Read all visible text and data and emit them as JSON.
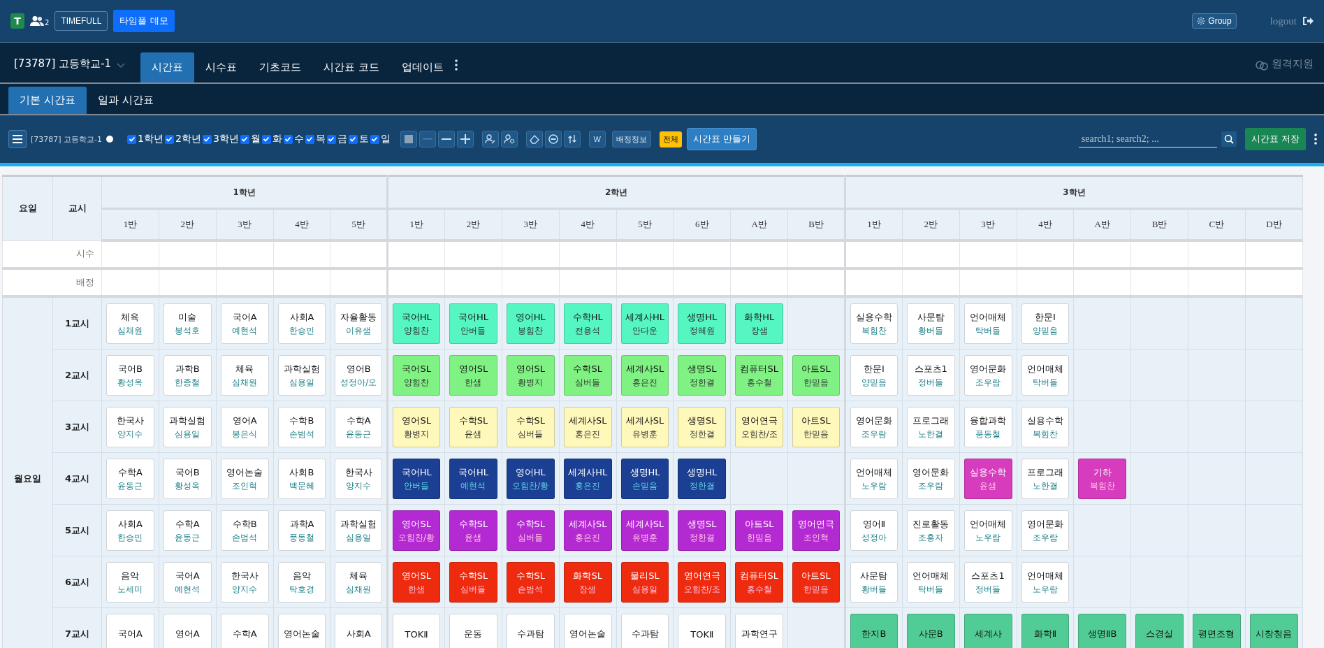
{
  "app_bar": {
    "logo": "T",
    "user_count": "2",
    "brand_button": "TIMEFULL",
    "demo_button": "타임풀 데모",
    "group_button": "Group",
    "logout": "logout"
  },
  "nav": {
    "school": "[73787] 고등학교-1",
    "remote": "원격지원",
    "tabs": [
      {
        "label": "시간표",
        "selected": true
      },
      {
        "label": "시수표",
        "selected": false
      },
      {
        "label": "기초코드",
        "selected": false
      },
      {
        "label": "시간표 코드",
        "selected": false
      },
      {
        "label": "업데이트",
        "selected": false
      }
    ]
  },
  "subtabs": [
    {
      "label": "기본 시간표",
      "selected": true
    },
    {
      "label": "일과 시간표",
      "selected": false
    }
  ],
  "toolbar": {
    "school": "[73787] 고등학교-1",
    "w_button": "W",
    "info_button": "배정정보",
    "all_badge": "전체",
    "make_button": "시간표 만들기",
    "search": {
      "placeholder": "search1; search2; ..."
    },
    "save_button": "시간표 저장",
    "filters": [
      {
        "label": "1학년",
        "checked": true
      },
      {
        "label": "2학년",
        "checked": true
      },
      {
        "label": "3학년",
        "checked": true
      },
      {
        "label": "월",
        "checked": true
      },
      {
        "label": "화",
        "checked": true
      },
      {
        "label": "수",
        "checked": true
      },
      {
        "label": "목",
        "checked": true
      },
      {
        "label": "금",
        "checked": true
      },
      {
        "label": "토",
        "checked": true
      },
      {
        "label": "일",
        "checked": true
      }
    ]
  },
  "table": {
    "day_header": "요일",
    "period_header": "교시",
    "summary_rows": [
      "시수",
      "배정"
    ],
    "day": "월요일",
    "grades": [
      {
        "name": "1학년",
        "classes": [
          "1반",
          "2반",
          "3반",
          "4반",
          "5반"
        ]
      },
      {
        "name": "2학년",
        "classes": [
          "1반",
          "2반",
          "3반",
          "4반",
          "5반",
          "6반",
          "A반",
          "B반"
        ]
      },
      {
        "name": "3학년",
        "classes": [
          "1반",
          "2반",
          "3반",
          "4반",
          "A반",
          "B반",
          "C반",
          "D반"
        ]
      }
    ],
    "periods": [
      {
        "label": "1교시",
        "cells": [
          {
            "subject": "체육",
            "teacher": "심채원",
            "color": "#ffffff"
          },
          {
            "subject": "미술",
            "teacher": "봉석호",
            "color": "#ffffff"
          },
          {
            "subject": "국어A",
            "teacher": "예현석",
            "color": "#ffffff"
          },
          {
            "subject": "사회A",
            "teacher": "한승민",
            "color": "#ffffff"
          },
          {
            "subject": "자율활동",
            "teacher": "이유샘",
            "color": "#ffffff"
          },
          {
            "subject": "국어HL",
            "teacher": "양힘찬",
            "color": "#56f6c2"
          },
          {
            "subject": "국어HL",
            "teacher": "안버들",
            "color": "#56f6c2"
          },
          {
            "subject": "영어HL",
            "teacher": "봉힘찬",
            "color": "#56f6c2"
          },
          {
            "subject": "수학HL",
            "teacher": "전용석",
            "color": "#56f6c2"
          },
          {
            "subject": "세계사HL",
            "teacher": "안다운",
            "color": "#56f6c2"
          },
          {
            "subject": "생명HL",
            "teacher": "정혜원",
            "color": "#56f6c2"
          },
          {
            "subject": "화학HL",
            "teacher": "장샘",
            "color": "#56f6c2"
          },
          null,
          {
            "subject": "실용수학",
            "teacher": "복힘찬",
            "color": "#ffffff"
          },
          {
            "subject": "사문탐",
            "teacher": "황버들",
            "color": "#ffffff"
          },
          {
            "subject": "언어매체",
            "teacher": "탁버들",
            "color": "#ffffff"
          },
          {
            "subject": "한문Ⅰ",
            "teacher": "양믿음",
            "color": "#ffffff"
          },
          null,
          null,
          null,
          null
        ]
      },
      {
        "label": "2교시",
        "cells": [
          {
            "subject": "국어B",
            "teacher": "황성옥",
            "color": "#ffffff"
          },
          {
            "subject": "과학B",
            "teacher": "한종철",
            "color": "#ffffff"
          },
          {
            "subject": "체육",
            "teacher": "심채원",
            "color": "#ffffff"
          },
          {
            "subject": "과학실험",
            "teacher": "심용일",
            "color": "#ffffff"
          },
          {
            "subject": "영어B",
            "teacher": "성정아/오",
            "color": "#ffffff"
          },
          {
            "subject": "국어SL",
            "teacher": "양힘찬",
            "color": "#80f284"
          },
          {
            "subject": "영어SL",
            "teacher": "한샘",
            "color": "#80f284"
          },
          {
            "subject": "영어SL",
            "teacher": "황병지",
            "color": "#80f284"
          },
          {
            "subject": "수학SL",
            "teacher": "심버들",
            "color": "#80f284"
          },
          {
            "subject": "세계사SL",
            "teacher": "홍은진",
            "color": "#80f284"
          },
          {
            "subject": "생명SL",
            "teacher": "정한결",
            "color": "#80f284"
          },
          {
            "subject": "컴퓨터SL",
            "teacher": "홍수철",
            "color": "#80f284"
          },
          {
            "subject": "아트SL",
            "teacher": "한믿음",
            "color": "#80f284"
          },
          {
            "subject": "한문Ⅰ",
            "teacher": "양믿음",
            "color": "#ffffff"
          },
          {
            "subject": "스포츠1",
            "teacher": "정버들",
            "color": "#ffffff"
          },
          {
            "subject": "영어문화",
            "teacher": "조우람",
            "color": "#ffffff"
          },
          {
            "subject": "언어매체",
            "teacher": "탁버들",
            "color": "#ffffff"
          },
          null,
          null,
          null,
          null
        ]
      },
      {
        "label": "3교시",
        "cells": [
          {
            "subject": "한국사",
            "teacher": "양지수",
            "color": "#ffffff"
          },
          {
            "subject": "과학실험",
            "teacher": "심용일",
            "color": "#ffffff"
          },
          {
            "subject": "영어A",
            "teacher": "봉은식",
            "color": "#ffffff"
          },
          {
            "subject": "수학B",
            "teacher": "손범석",
            "color": "#ffffff"
          },
          {
            "subject": "수학A",
            "teacher": "윤동근",
            "color": "#ffffff"
          },
          {
            "subject": "영어SL",
            "teacher": "황병지",
            "color": "#fff8bb"
          },
          {
            "subject": "수학SL",
            "teacher": "윤샘",
            "color": "#fff8bb"
          },
          {
            "subject": "수학SL",
            "teacher": "심버들",
            "color": "#fff8bb"
          },
          {
            "subject": "세계사SL",
            "teacher": "홍은진",
            "color": "#fff8bb"
          },
          {
            "subject": "세계사SL",
            "teacher": "유병훈",
            "color": "#fff8bb"
          },
          {
            "subject": "생명SL",
            "teacher": "정한결",
            "color": "#fff8bb"
          },
          {
            "subject": "영어연극",
            "teacher": "오힘찬/조",
            "color": "#fff8bb"
          },
          {
            "subject": "아트SL",
            "teacher": "한믿음",
            "color": "#fff8bb"
          },
          {
            "subject": "영어문화",
            "teacher": "조우람",
            "color": "#ffffff"
          },
          {
            "subject": "프로그래",
            "teacher": "노한결",
            "color": "#ffffff"
          },
          {
            "subject": "융합과학",
            "teacher": "풍동철",
            "color": "#ffffff"
          },
          {
            "subject": "실용수학",
            "teacher": "복힘찬",
            "color": "#ffffff"
          },
          null,
          null,
          null,
          null
        ]
      },
      {
        "label": "4교시",
        "cells": [
          {
            "subject": "수학A",
            "teacher": "윤동근",
            "color": "#ffffff"
          },
          {
            "subject": "국어B",
            "teacher": "황성옥",
            "color": "#ffffff"
          },
          {
            "subject": "영어논술",
            "teacher": "조인혁",
            "color": "#ffffff"
          },
          {
            "subject": "사회B",
            "teacher": "백문혜",
            "color": "#ffffff"
          },
          {
            "subject": "한국사",
            "teacher": "양지수",
            "color": "#ffffff"
          },
          {
            "subject": "국어HL",
            "teacher": "안버들",
            "color": "#1b3f93"
          },
          {
            "subject": "국어HL",
            "teacher": "예현석",
            "color": "#1b3f93"
          },
          {
            "subject": "영어HL",
            "teacher": "오힘찬/황",
            "color": "#1b3f93"
          },
          {
            "subject": "세계사HL",
            "teacher": "홍은진",
            "color": "#1b3f93"
          },
          {
            "subject": "생명HL",
            "teacher": "손믿음",
            "color": "#1b3f93"
          },
          {
            "subject": "생명HL",
            "teacher": "정한결",
            "color": "#1b3f93"
          },
          null,
          null,
          {
            "subject": "언어매체",
            "teacher": "노우람",
            "color": "#ffffff"
          },
          {
            "subject": "영어문화",
            "teacher": "조우람",
            "color": "#ffffff"
          },
          {
            "subject": "실용수학",
            "teacher": "윤샘",
            "color": "#d63cbd"
          },
          {
            "subject": "프로그래",
            "teacher": "노한결",
            "color": "#ffffff"
          },
          {
            "subject": "기하",
            "teacher": "복힘찬",
            "color": "#d63cbd"
          },
          null,
          null,
          null
        ]
      },
      {
        "label": "5교시",
        "cells": [
          {
            "subject": "사회A",
            "teacher": "한승민",
            "color": "#ffffff"
          },
          {
            "subject": "수학A",
            "teacher": "윤동근",
            "color": "#ffffff"
          },
          {
            "subject": "수학B",
            "teacher": "손범석",
            "color": "#ffffff"
          },
          {
            "subject": "과학A",
            "teacher": "풍동철",
            "color": "#ffffff"
          },
          {
            "subject": "과학실험",
            "teacher": "심용일",
            "color": "#ffffff"
          },
          {
            "subject": "영어SL",
            "teacher": "오힘찬/황",
            "color": "#b42ad2"
          },
          {
            "subject": "수학SL",
            "teacher": "윤샘",
            "color": "#b42ad2"
          },
          {
            "subject": "수학SL",
            "teacher": "심버들",
            "color": "#b42ad2"
          },
          {
            "subject": "세계사SL",
            "teacher": "홍은진",
            "color": "#b42ad2"
          },
          {
            "subject": "세계사SL",
            "teacher": "유병훈",
            "color": "#b42ad2"
          },
          {
            "subject": "생명SL",
            "teacher": "정한결",
            "color": "#b42ad2"
          },
          {
            "subject": "아트SL",
            "teacher": "한믿음",
            "color": "#b42ad2"
          },
          {
            "subject": "영어연극",
            "teacher": "조인혁",
            "color": "#b42ad2"
          },
          {
            "subject": "영어Ⅱ",
            "teacher": "성정아",
            "color": "#ffffff"
          },
          {
            "subject": "진로활동",
            "teacher": "조홍자",
            "color": "#ffffff"
          },
          {
            "subject": "언어매체",
            "teacher": "노우람",
            "color": "#ffffff"
          },
          {
            "subject": "영어문화",
            "teacher": "조우람",
            "color": "#ffffff"
          },
          null,
          null,
          null,
          null
        ]
      },
      {
        "label": "6교시",
        "cells": [
          {
            "subject": "음악",
            "teacher": "노세미",
            "color": "#ffffff"
          },
          {
            "subject": "국어A",
            "teacher": "예현석",
            "color": "#ffffff"
          },
          {
            "subject": "한국사",
            "teacher": "양지수",
            "color": "#ffffff"
          },
          {
            "subject": "음악",
            "teacher": "탁호경",
            "color": "#ffffff"
          },
          {
            "subject": "체육",
            "teacher": "심채원",
            "color": "#ffffff"
          },
          {
            "subject": "영어SL",
            "teacher": "한샘",
            "color": "#ee2b0f"
          },
          {
            "subject": "수학SL",
            "teacher": "심버들",
            "color": "#ee2b0f"
          },
          {
            "subject": "수학SL",
            "teacher": "손범석",
            "color": "#ee2b0f"
          },
          {
            "subject": "화학SL",
            "teacher": "장샘",
            "color": "#ee2b0f"
          },
          {
            "subject": "물리SL",
            "teacher": "심용일",
            "color": "#ee2b0f"
          },
          {
            "subject": "영어연극",
            "teacher": "오힘찬/조",
            "color": "#ee2b0f"
          },
          {
            "subject": "컴퓨터SL",
            "teacher": "홍수철",
            "color": "#ee2b0f"
          },
          {
            "subject": "아트SL",
            "teacher": "한믿음",
            "color": "#ee2b0f"
          },
          {
            "subject": "사문탐",
            "teacher": "황버들",
            "color": "#ffffff"
          },
          {
            "subject": "언어매체",
            "teacher": "탁버들",
            "color": "#ffffff"
          },
          {
            "subject": "스포츠1",
            "teacher": "정버들",
            "color": "#ffffff"
          },
          {
            "subject": "언어매체",
            "teacher": "노우람",
            "color": "#ffffff"
          },
          null,
          null,
          null,
          null
        ]
      },
      {
        "label": "7교시",
        "cells": [
          {
            "subject": "국어A",
            "color": "#ffffff"
          },
          {
            "subject": "영어A",
            "color": "#ffffff"
          },
          {
            "subject": "수학A",
            "color": "#ffffff"
          },
          {
            "subject": "영어논술",
            "color": "#ffffff"
          },
          {
            "subject": "사회A",
            "color": "#ffffff"
          },
          {
            "subject": "TOKⅡ",
            "color": "#ffffff"
          },
          {
            "subject": "운동",
            "color": "#ffffff"
          },
          {
            "subject": "수과탐",
            "color": "#ffffff"
          },
          {
            "subject": "영어논술",
            "color": "#ffffff"
          },
          {
            "subject": "수과탐",
            "color": "#ffffff"
          },
          {
            "subject": "TOKⅡ",
            "color": "#ffffff"
          },
          {
            "subject": "과학연구",
            "color": "#ffffff"
          },
          null,
          {
            "subject": "한지B",
            "color": "#52cc97"
          },
          {
            "subject": "사문B",
            "color": "#52cc97"
          },
          {
            "subject": "세계사",
            "color": "#52cc97"
          },
          {
            "subject": "화학Ⅱ",
            "color": "#52cc97"
          },
          {
            "subject": "생명ⅡB",
            "color": "#52cc97"
          },
          {
            "subject": "스경실",
            "color": "#52cc97"
          },
          {
            "subject": "평면조형",
            "color": "#52cc97"
          },
          {
            "subject": "시창청음",
            "color": "#52cc97"
          }
        ]
      }
    ]
  }
}
